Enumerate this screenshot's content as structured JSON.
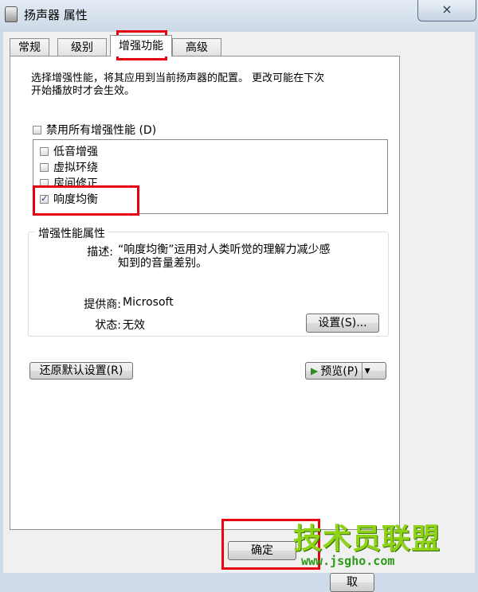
{
  "window": {
    "title": "扬声器 属性",
    "close_label": "×"
  },
  "tabs": [
    {
      "label": "常规"
    },
    {
      "label": "级别"
    },
    {
      "label": "增强功能"
    },
    {
      "label": "高级"
    }
  ],
  "enhancements": {
    "description_line1": "选择增强性能，将其应用到当前扬声器的配置。 更改可能在下次",
    "description_line2": "开始播放时才会生效。",
    "disable_all_label": "禁用所有增强性能 (D)",
    "disable_all_checked": false,
    "items": [
      {
        "label": "低音增强",
        "checked": false
      },
      {
        "label": "虚拟环绕",
        "checked": false
      },
      {
        "label": "房间修正",
        "checked": false
      },
      {
        "label": "响度均衡",
        "checked": true
      }
    ]
  },
  "properties": {
    "legend": "增强性能属性",
    "description_label": "描述:",
    "description_value_line1": "“响度均衡”运用对人类听觉的理解力减少感",
    "description_value_line2": "知到的音量差别。",
    "provider_label": "提供商:",
    "provider_value": "Microsoft",
    "status_label": "状态:",
    "status_value": "无效",
    "settings_button": "设置(S)..."
  },
  "actions": {
    "restore_defaults": "还原默认设置(R)",
    "preview_button": "预览(P)",
    "preview_dropdown": "▾",
    "ok_button": "确定",
    "cancel_button_partial": "取"
  },
  "watermark": {
    "text": "技术员联盟",
    "url": "www.jsgho.com"
  }
}
